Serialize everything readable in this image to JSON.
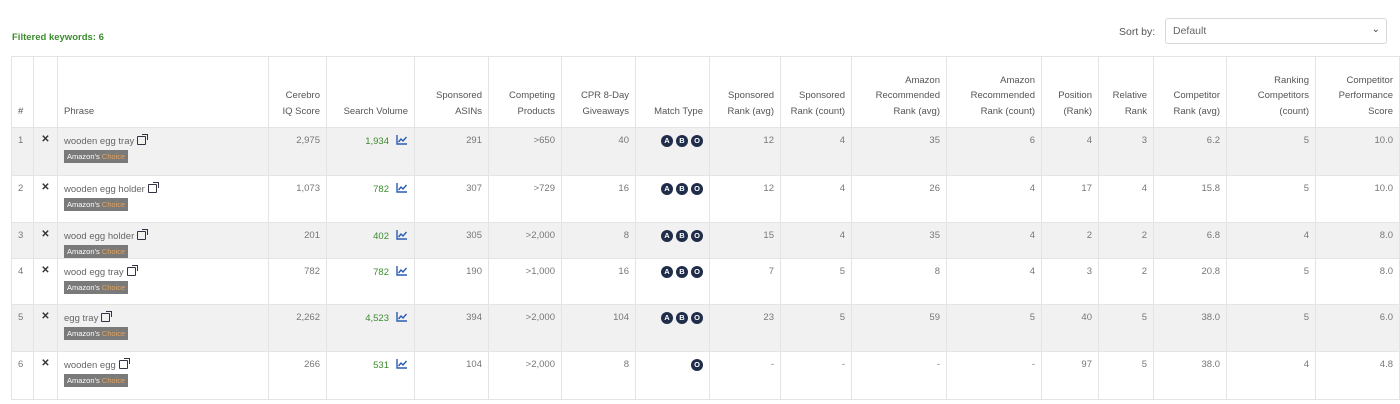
{
  "header": {
    "filtered_label": "Filtered keywords: 6",
    "sort_label": "Sort by:",
    "sort_value": "Default"
  },
  "table": {
    "columns": [
      "#",
      "",
      "Phrase",
      "Cerebro IQ Score",
      "Search Volume",
      "Sponsored ASINs",
      "Competing Products",
      "CPR 8-Day Giveaways",
      "Match Type",
      "Sponsored Rank (avg)",
      "Sponsored Rank (count)",
      "Amazon Recommended Rank (avg)",
      "Amazon Recommended Rank (count)",
      "Position (Rank)",
      "Relative Rank",
      "Competitor Rank (avg)",
      "Ranking Competitors (count)",
      "Competitor Performance Score"
    ],
    "badge": {
      "prefix": "Amazon's",
      "suffix": "Choice"
    },
    "rows": [
      {
        "idx": "1",
        "phrase": "wooden egg tray",
        "iq": "2,975",
        "sv": "1,934",
        "asins": "291",
        "competing": ">650",
        "cpr": "40",
        "match": [
          "A",
          "B",
          "O"
        ],
        "spr_avg": "12",
        "spr_cnt": "4",
        "arr_avg": "35",
        "arr_cnt": "6",
        "pos": "4",
        "rel": "3",
        "cr_avg": "6.2",
        "rc_cnt": "5",
        "cps": "10.0"
      },
      {
        "idx": "2",
        "phrase": "wooden egg holder",
        "iq": "1,073",
        "sv": "782",
        "asins": "307",
        "competing": ">729",
        "cpr": "16",
        "match": [
          "A",
          "B",
          "O"
        ],
        "spr_avg": "12",
        "spr_cnt": "4",
        "arr_avg": "26",
        "arr_cnt": "4",
        "pos": "17",
        "rel": "4",
        "cr_avg": "15.8",
        "rc_cnt": "5",
        "cps": "10.0"
      },
      {
        "idx": "3",
        "phrase": "wood egg holder",
        "iq": "201",
        "sv": "402",
        "asins": "305",
        "competing": ">2,000",
        "cpr": "8",
        "match": [
          "A",
          "B",
          "O"
        ],
        "spr_avg": "15",
        "spr_cnt": "4",
        "arr_avg": "35",
        "arr_cnt": "4",
        "pos": "2",
        "rel": "2",
        "cr_avg": "6.8",
        "rc_cnt": "4",
        "cps": "8.0"
      },
      {
        "idx": "4",
        "phrase": "wood egg tray",
        "iq": "782",
        "sv": "782",
        "asins": "190",
        "competing": ">1,000",
        "cpr": "16",
        "match": [
          "A",
          "B",
          "O"
        ],
        "spr_avg": "7",
        "spr_cnt": "5",
        "arr_avg": "8",
        "arr_cnt": "4",
        "pos": "3",
        "rel": "2",
        "cr_avg": "20.8",
        "rc_cnt": "5",
        "cps": "8.0"
      },
      {
        "idx": "5",
        "phrase": "egg tray",
        "iq": "2,262",
        "sv": "4,523",
        "asins": "394",
        "competing": ">2,000",
        "cpr": "104",
        "match": [
          "A",
          "B",
          "O"
        ],
        "spr_avg": "23",
        "spr_cnt": "5",
        "arr_avg": "59",
        "arr_cnt": "5",
        "pos": "40",
        "rel": "5",
        "cr_avg": "38.0",
        "rc_cnt": "5",
        "cps": "6.0"
      },
      {
        "idx": "6",
        "phrase": "wooden egg",
        "iq": "266",
        "sv": "531",
        "asins": "104",
        "competing": ">2,000",
        "cpr": "8",
        "match": [
          "O"
        ],
        "spr_avg": "-",
        "spr_cnt": "-",
        "arr_avg": "-",
        "arr_cnt": "-",
        "pos": "97",
        "rel": "5",
        "cr_avg": "38.0",
        "rc_cnt": "4",
        "cps": "4.8"
      }
    ]
  },
  "colors": {
    "accent_green": "#3c8c2f",
    "match_badge": "#1f2d4a",
    "stripe": "#f1f1f1"
  },
  "icons": {
    "remove": "close-icon",
    "external": "external-link-icon",
    "trend": "chart-line-icon",
    "sort": "chevron-down-icon"
  }
}
